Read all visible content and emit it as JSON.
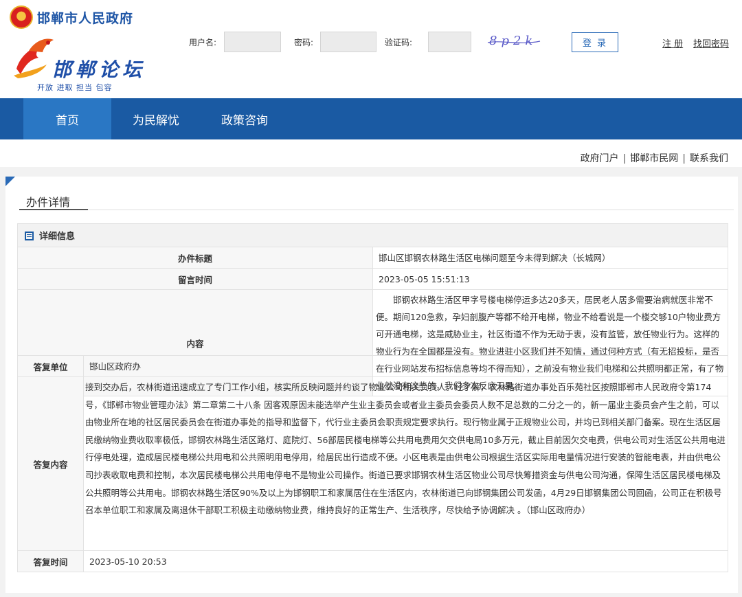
{
  "header": {
    "gov_title": "邯郸市人民政府",
    "forum_name": "邯郸论坛",
    "forum_slogan": "开放 进取 担当 包容"
  },
  "login": {
    "username_label": "用户名:",
    "username_value": "",
    "password_label": "密码:",
    "password_value": "",
    "captcha_label": "验证码:",
    "captcha_value": "",
    "captcha_text": "8p2k",
    "login_button": "登 录",
    "register_link": "注 册",
    "find_password_link": "找回密码"
  },
  "nav": {
    "items": [
      {
        "label": "首页",
        "active": true
      },
      {
        "label": "为民解忧",
        "active": false
      },
      {
        "label": "政策咨询",
        "active": false
      }
    ]
  },
  "toplinks": {
    "items": [
      "政府门户",
      "邯郸市民网",
      "联系我们"
    ],
    "separator": "|"
  },
  "page": {
    "section_title": "办件详情"
  },
  "detail": {
    "heading": "详细信息",
    "title_label": "办件标题",
    "title_value": "邯山区邯钢农林路生活区电梯问题至今未得到解决（长城网）",
    "time_label": "留言时间",
    "time_value": "2023-05-05 15:51:13",
    "content_label": "内容",
    "content_value": "邯钢农林路生活区甲字号楼电梯停运多达20多天，居民老人居多需要治病就医非常不便。期间120急救，孕妇剖腹产等都不给开电梯，物业不给看说是一个楼交够10户物业费方可开通电梯，这是威胁业主，社区街道不作为无动于衷，没有监管，放任物业行为。这样的物业行为在全国都是没有。物业进驻小区我们并不知情，通过何种方式（有无招投标，是否在行业网站发布招标信息等均不得而知），之前没有物业我们电梯和公共照明都正常，有了物业就没有这些的，我们多次反应无果。"
  },
  "reply": {
    "unit_label": "答复单位",
    "unit_value": "邯山区政府办",
    "content_label": "答复内容",
    "content_value": "接到交办后，农林街道迅速成立了专门工作小组，核实所反映问题并约谈了物业公司相关负责人。经了解，农林路街道办事处百乐苑社区按照邯郸市人民政府令第174号，《邯郸市物业管理办法》第二章第二十八条 因客观原因未能选举产生业主委员会或者业主委员会委员人数不足总数的二分之一的，新一届业主委员会产生之前，可以由物业所在地的社区居民委员会在街道办事处的指导和监督下，代行业主委员会职责规定要求执行。现行物业属于正规物业公司，并均已到相关部门备案。现在生活区居民缴纳物业费收取率极低，邯钢农林路生活区路灯、庭院灯、56部居民楼电梯等公共用电费用欠交供电局10多万元，截止目前因欠交电费，供电公司对生活区公共用电进行停电处理，造成居民楼电梯公共用电和公共照明用电停用，给居民出行造成不便。小区电表是由供电公司根据生活区实际用电量情况进行安装的智能电表，并由供电公司抄表收取电费和控制，本次居民楼电梯公共用电停电不是物业公司操作。街道已要求邯钢农林生活区物业公司尽快筹措资金与供电公司沟通，保障生活区居民楼电梯及公共照明等公共用电。邯钢农林路生活区90%及以上为邯钢职工和家属居住在生活区内，农林街道已向邯钢集团公司发函，4月29日邯钢集团公司回函，公司正在积极号召本单位职工和家属及离退休干部职工积极主动缴纳物业费，维持良好的正常生产、生活秩序，尽快给予协调解决 。（邯山区政府办）",
    "time_label": "答复时间",
    "time_value": "2023-05-10 20:53"
  },
  "colors": {
    "brand_blue": "#1a5aa3",
    "nav_active": "#2a77c4",
    "page_bg": "#f2f2f2"
  },
  "icons": {
    "gov_emblem": "national-emblem-icon",
    "forum_logo": "forum-phoenix-logo-icon",
    "detail_heading": "document-list-icon"
  }
}
